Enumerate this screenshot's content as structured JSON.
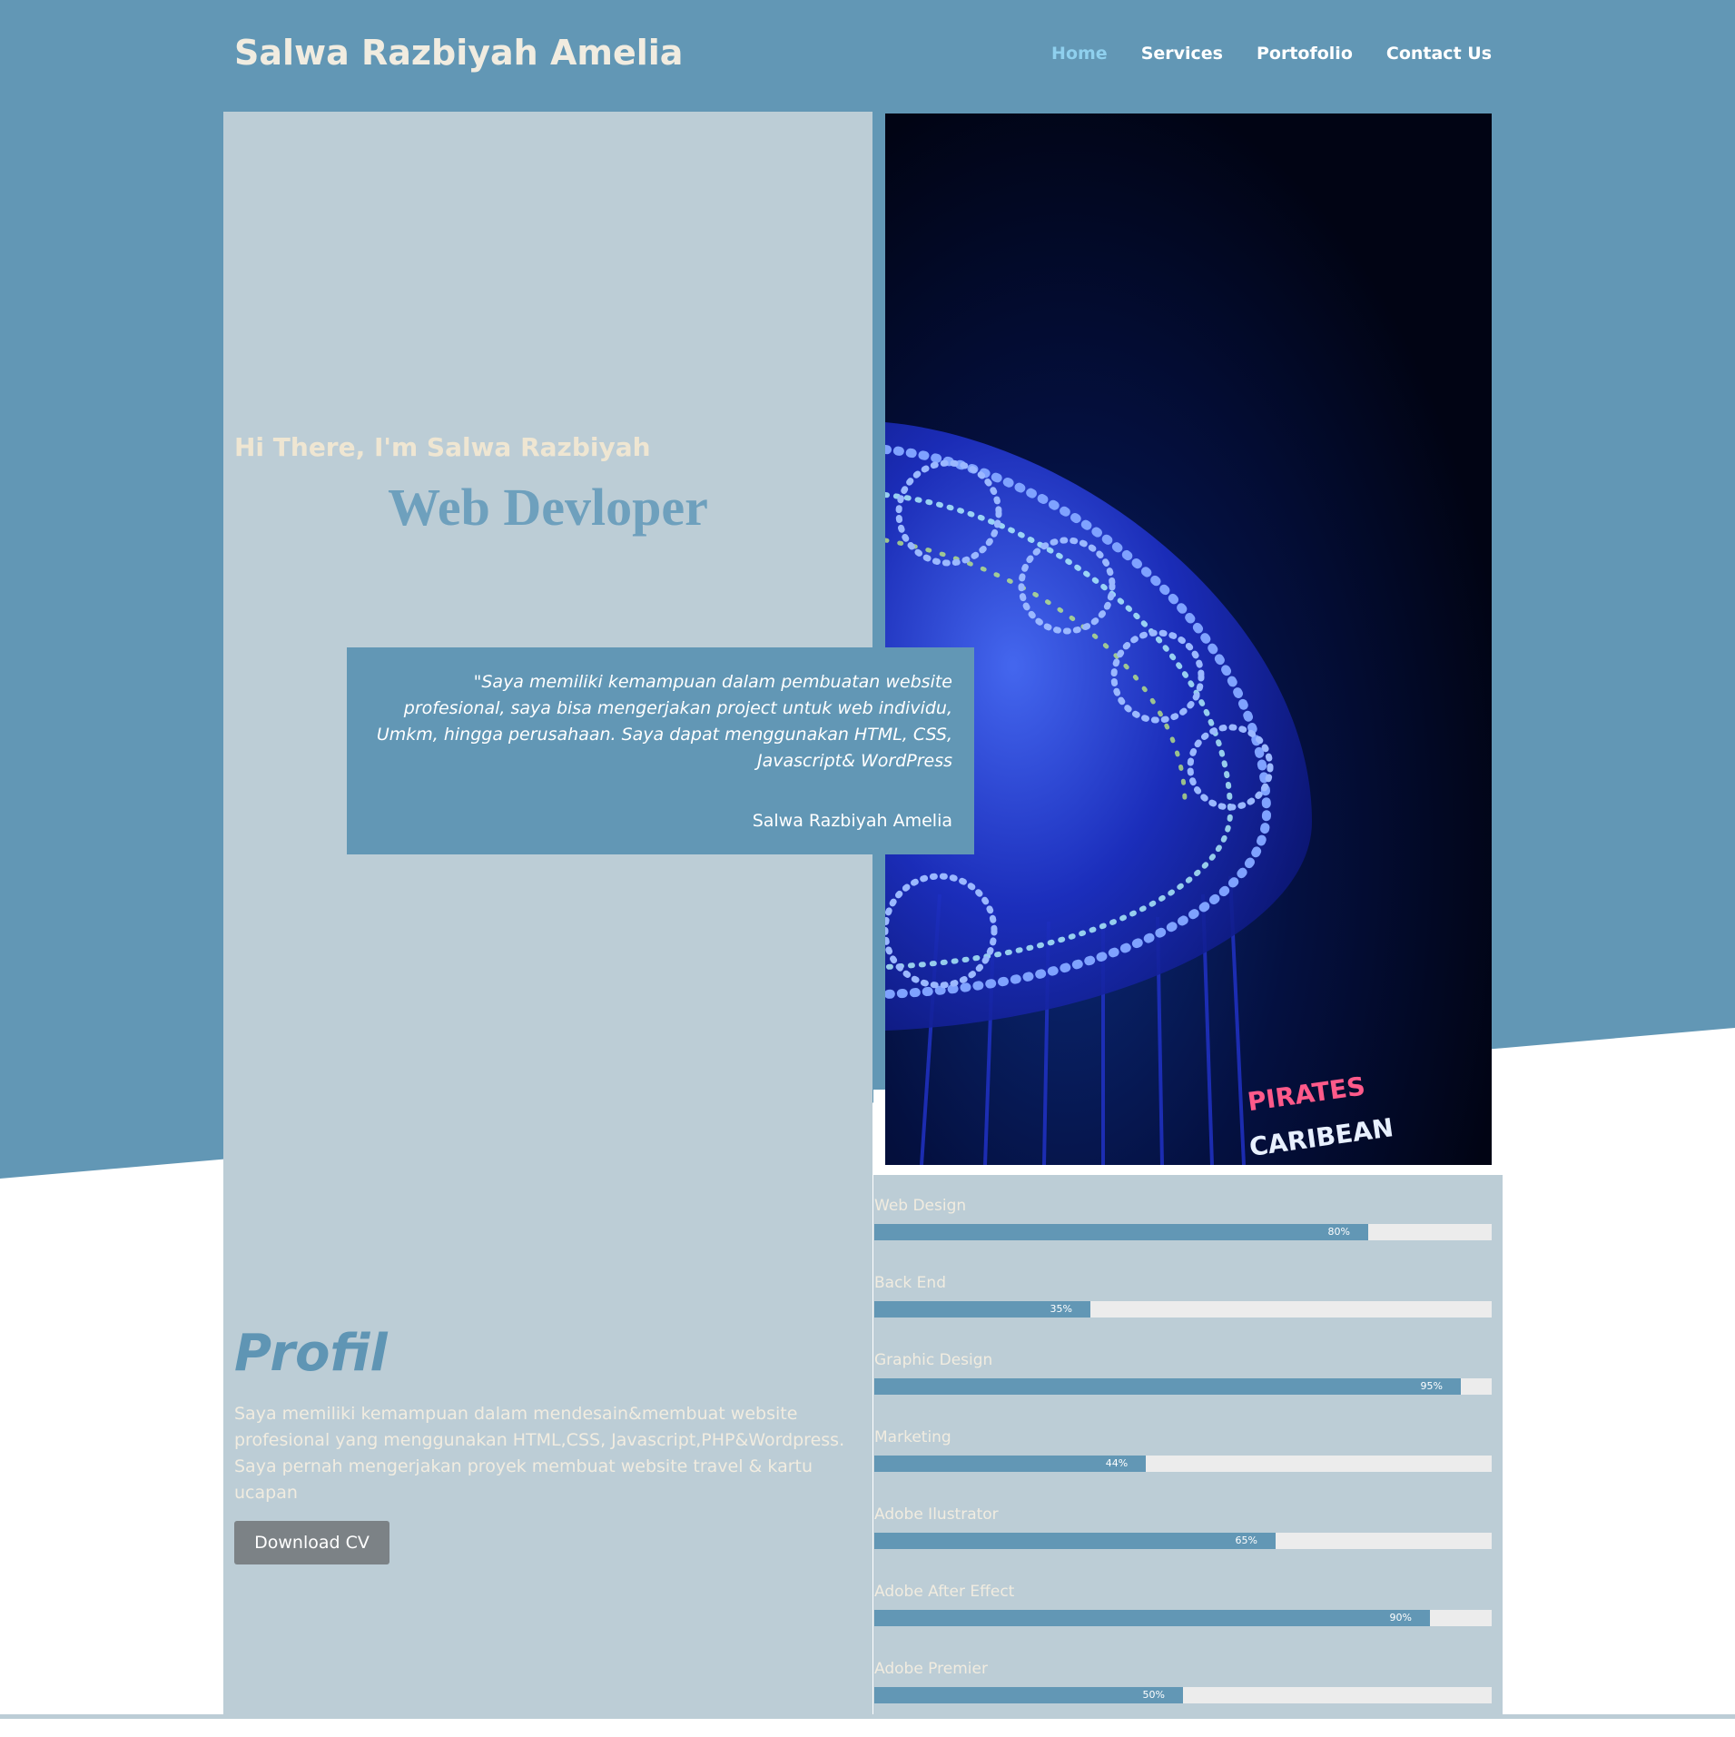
{
  "header": {
    "brand": "Salwa Razbiyah Amelia",
    "nav": [
      {
        "label": "Home",
        "active": true
      },
      {
        "label": "Services",
        "active": false
      },
      {
        "label": "Portofolio",
        "active": false
      },
      {
        "label": "Contact Us",
        "active": false
      }
    ]
  },
  "hero": {
    "greeting": "Hi There, I'm Salwa Razbiyah",
    "role": "Web Devloper",
    "quote": "\"Saya memiliki kemampuan dalam pembuatan website profesional, saya bisa mengerjakan project untuk web individu, Umkm, hingga perusahaan. Saya dapat menggunakan HTML, CSS, Javascript& WordPress",
    "quote_author": "Salwa Razbiyah Amelia",
    "photo_sign_top": "PIRATES",
    "photo_sign_bottom": "CARIBEAN"
  },
  "profile": {
    "title": "Profil",
    "text": "Saya memiliki kemampuan dalam mendesain&membuat website profesional yang menggunakan HTML,CSS, Javascript,PHP&Wordpress. Saya pernah mengerjakan proyek membuat website travel & kartu ucapan",
    "download_label": "Download CV"
  },
  "skills": [
    {
      "name": "Web Design",
      "percent": 80,
      "label": "80%"
    },
    {
      "name": "Back End",
      "percent": 35,
      "label": "35%"
    },
    {
      "name": "Graphic Design",
      "percent": 95,
      "label": "95%"
    },
    {
      "name": "Marketing",
      "percent": 44,
      "label": "44%"
    },
    {
      "name": "Adobe Ilustrator",
      "percent": 65,
      "label": "65%"
    },
    {
      "name": "Adobe After Effect",
      "percent": 90,
      "label": "90%"
    },
    {
      "name": "Adobe Premier",
      "percent": 50,
      "label": "50%"
    }
  ],
  "colors": {
    "accent": "#6297b5",
    "panel": "#bccdd6",
    "nav_active": "#8fd0ee",
    "button": "#7c8286"
  }
}
